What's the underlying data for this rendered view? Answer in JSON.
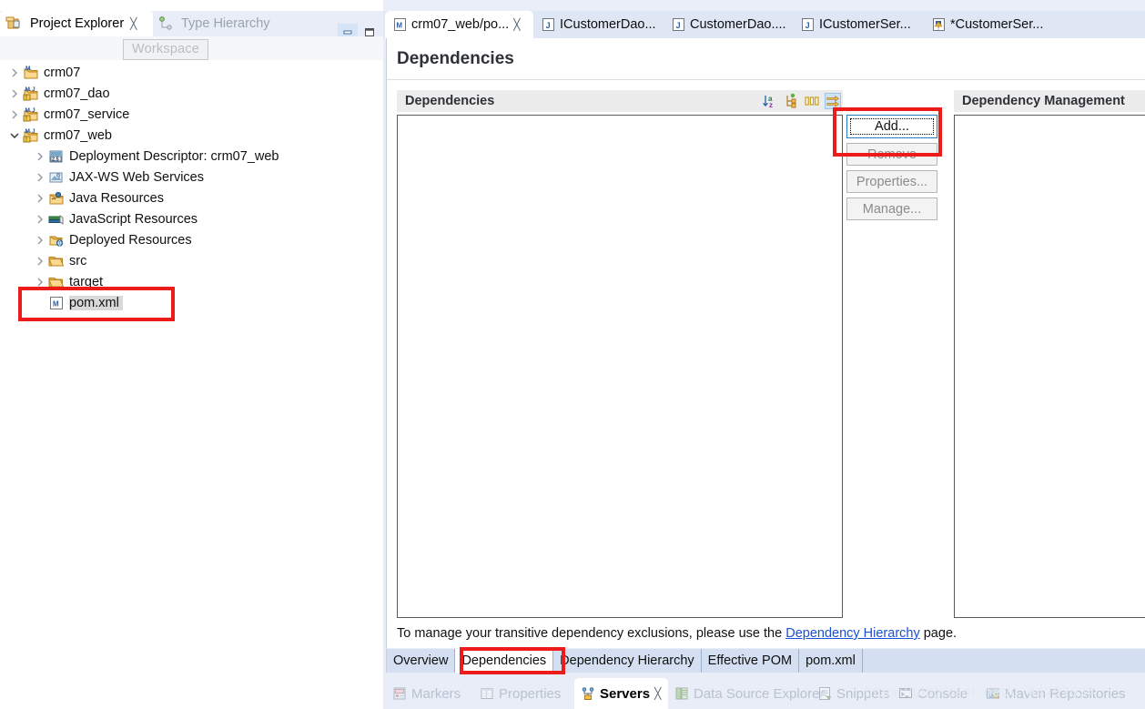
{
  "app": {
    "ide": "Eclipse IDE",
    "accent_blue": "#2a7ac0",
    "annotation_red": "#ee1b1b",
    "link_blue": "#1a4fd6"
  },
  "left_panel": {
    "tabs": [
      {
        "label": "Project Explorer",
        "icon": "project-explorer-icon",
        "active": true,
        "closeable": true
      },
      {
        "label": "Type Hierarchy",
        "icon": "type-hierarchy-icon",
        "active": false,
        "closeable": false
      }
    ],
    "window_buttons": [
      {
        "name": "minimize-button",
        "glyph": "–"
      },
      {
        "name": "maximize-button",
        "glyph": "▭"
      }
    ],
    "tooltip": "Workspace",
    "toolbar_icons": [
      "collapse-all-icon",
      "link-with-editor-icon",
      "view-menu-icon",
      "view-dropdown-icon"
    ],
    "tree": [
      {
        "label": "crm07",
        "indent": 0,
        "arrow": "collapsed",
        "icon": "maven-project-icon",
        "selected": false
      },
      {
        "label": "crm07_dao",
        "indent": 0,
        "arrow": "collapsed",
        "icon": "maven-java-project-icon",
        "selected": false
      },
      {
        "label": "crm07_service",
        "indent": 0,
        "arrow": "collapsed",
        "icon": "maven-java-project-icon",
        "selected": false
      },
      {
        "label": "crm07_web",
        "indent": 0,
        "arrow": "expanded",
        "icon": "maven-java-project-icon",
        "selected": false
      },
      {
        "label": "Deployment Descriptor: crm07_web",
        "indent": 1,
        "arrow": "collapsed",
        "icon": "deployment-descriptor-icon",
        "selected": false
      },
      {
        "label": "JAX-WS Web Services",
        "indent": 1,
        "arrow": "collapsed",
        "icon": "jaxws-icon",
        "selected": false
      },
      {
        "label": "Java Resources",
        "indent": 1,
        "arrow": "collapsed",
        "icon": "java-resources-icon",
        "selected": false
      },
      {
        "label": "JavaScript Resources",
        "indent": 1,
        "arrow": "collapsed",
        "icon": "javascript-resources-icon",
        "selected": false
      },
      {
        "label": "Deployed Resources",
        "indent": 1,
        "arrow": "collapsed",
        "icon": "deployed-resources-icon",
        "selected": false
      },
      {
        "label": "src",
        "indent": 1,
        "arrow": "collapsed",
        "icon": "folder-icon",
        "selected": false
      },
      {
        "label": "target",
        "indent": 1,
        "arrow": "collapsed",
        "icon": "folder-icon",
        "selected": false
      },
      {
        "label": "pom.xml",
        "indent": 1,
        "arrow": "none",
        "icon": "xml-file-icon",
        "selected": true
      }
    ]
  },
  "editor": {
    "tabs": [
      {
        "label": "crm07_web/po...",
        "icon": "maven-pom-icon",
        "active": true,
        "dirty": false,
        "closeable": true
      },
      {
        "label": "ICustomerDao...",
        "icon": "java-file-icon",
        "active": false,
        "dirty": false,
        "closeable": false
      },
      {
        "label": "CustomerDao....",
        "icon": "java-file-icon",
        "active": false,
        "dirty": false,
        "closeable": false
      },
      {
        "label": "ICustomerSer...",
        "icon": "java-file-icon",
        "active": false,
        "dirty": false,
        "closeable": false
      },
      {
        "label": "*CustomerSer...",
        "icon": "java-file-dirty-icon",
        "active": false,
        "dirty": true,
        "closeable": false
      }
    ],
    "form_title": "Dependencies",
    "sections": {
      "dependencies": {
        "title": "Dependencies",
        "list_items": [],
        "toolbar_icons": [
          {
            "name": "sort-icon",
            "active": false
          },
          {
            "name": "hierarchy-layout-icon",
            "active": false
          },
          {
            "name": "columns-icon",
            "active": false
          },
          {
            "name": "flat-layout-icon",
            "active": true
          }
        ]
      },
      "dependency_management": {
        "title": "Dependency Management",
        "list_items": []
      }
    },
    "buttons": [
      {
        "label": "Add...",
        "enabled": true,
        "focused": true
      },
      {
        "label": "Remove",
        "enabled": false,
        "focused": false
      },
      {
        "label": "Properties...",
        "enabled": false,
        "focused": false
      },
      {
        "label": "Manage...",
        "enabled": false,
        "focused": false
      }
    ],
    "hint": {
      "before": "To manage your transitive dependency exclusions, please use the ",
      "link": "Dependency Hierarchy",
      "after": " page."
    },
    "form_tabs": [
      {
        "label": "Overview",
        "active": false
      },
      {
        "label": "Dependencies",
        "active": true
      },
      {
        "label": "Dependency Hierarchy",
        "active": false
      },
      {
        "label": "Effective POM",
        "active": false
      },
      {
        "label": "pom.xml",
        "active": false
      }
    ]
  },
  "bottom_views": [
    {
      "label": "Markers",
      "icon": "markers-icon",
      "active": false,
      "closeable": false
    },
    {
      "label": "Properties",
      "icon": "properties-icon",
      "active": false,
      "closeable": false
    },
    {
      "label": "Servers",
      "icon": "servers-icon",
      "active": true,
      "closeable": true
    },
    {
      "label": "Data Source Explorer",
      "icon": "data-source-explorer-icon",
      "active": false,
      "closeable": false
    },
    {
      "label": "Snippets",
      "icon": "snippets-icon",
      "active": false,
      "closeable": false
    },
    {
      "label": "Console",
      "icon": "console-icon",
      "active": false,
      "closeable": false
    },
    {
      "label": "Maven Repositories",
      "icon": "maven-repositories-icon",
      "active": false,
      "closeable": false
    }
  ],
  "annotations": [
    {
      "name": "pom-xml-highlight",
      "target": "pom.xml tree item"
    },
    {
      "name": "add-button-highlight",
      "target": "Add... button"
    },
    {
      "name": "dependencies-tab-highlight",
      "target": "Dependencies form tab"
    }
  ]
}
